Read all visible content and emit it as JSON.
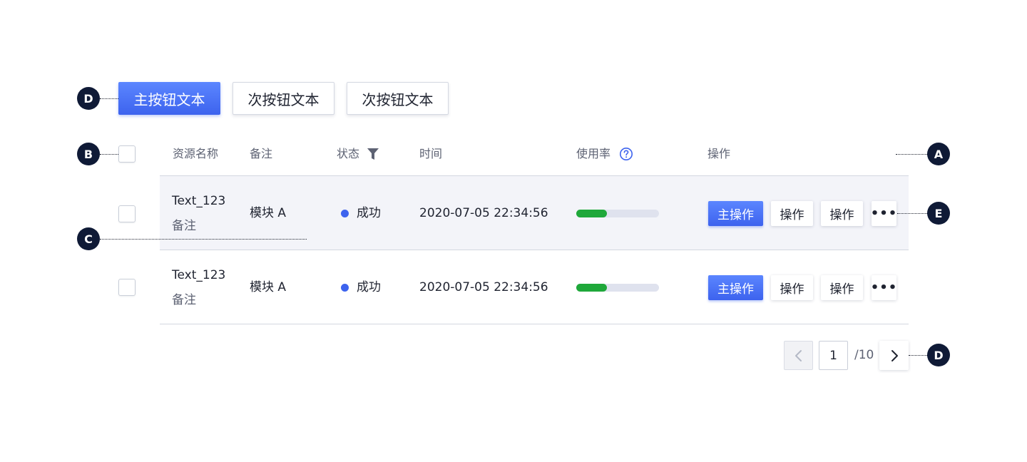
{
  "toolbar": {
    "primary_label": "主按钮文本",
    "secondary_labels": [
      "次按钮文本",
      "次按钮文本"
    ]
  },
  "table": {
    "columns": [
      "资源名称",
      "备注",
      "状态",
      "时间",
      "使用率",
      "操作"
    ],
    "status_filter_icon": "filter-icon",
    "usage_help_icon": "help-circle-icon",
    "rows": [
      {
        "name": "Text_123",
        "note_sub": "备注",
        "module": "模块 A",
        "status": "成功",
        "time": "2020-07-05 22:34:56",
        "usage": 0.37,
        "actions": {
          "primary": "主操作",
          "secondary1": "操作",
          "secondary2": "操作",
          "more": "•••"
        }
      },
      {
        "name": "Text_123",
        "note_sub": "备注",
        "module": "模块 A",
        "status": "成功",
        "time": "2020-07-05 22:34:56",
        "usage": 0.37,
        "actions": {
          "primary": "主操作",
          "secondary1": "操作",
          "secondary2": "操作",
          "more": "•••"
        }
      }
    ]
  },
  "pagination": {
    "current": "1",
    "total": "/10"
  },
  "annotations": {
    "toolbar": "D",
    "select_all": "B",
    "header": "A",
    "row_hover": "C",
    "row_actions": "E",
    "pagination": "D"
  },
  "colors": {
    "primary": "#3d63ee",
    "success": "#1fa83a",
    "marker": "#0f1a36",
    "row_hover_bg": "#f3f4f9"
  }
}
